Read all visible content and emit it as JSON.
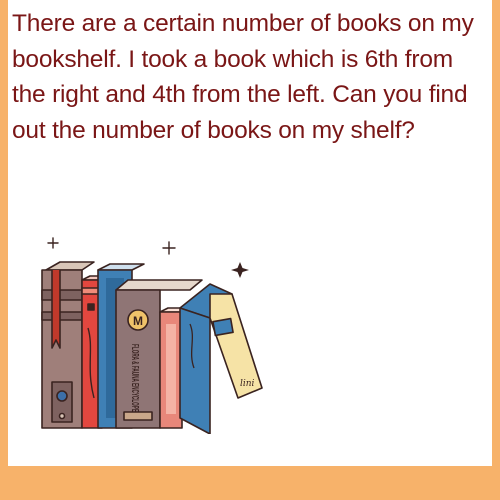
{
  "question": {
    "text": "There are a certain number of books on my bookshelf. I took a book which is 6th from the right and 4th from the left. Can you find out the number of books on my shelf?"
  },
  "illustration": {
    "spines": {
      "book_1": "M",
      "book_2": "FLORA & FAUNA ENCYCLOPEDIA",
      "book_3": "lini"
    }
  },
  "colors": {
    "background": "#f7b26a",
    "text": "#7a1616",
    "card": "#ffffff"
  }
}
